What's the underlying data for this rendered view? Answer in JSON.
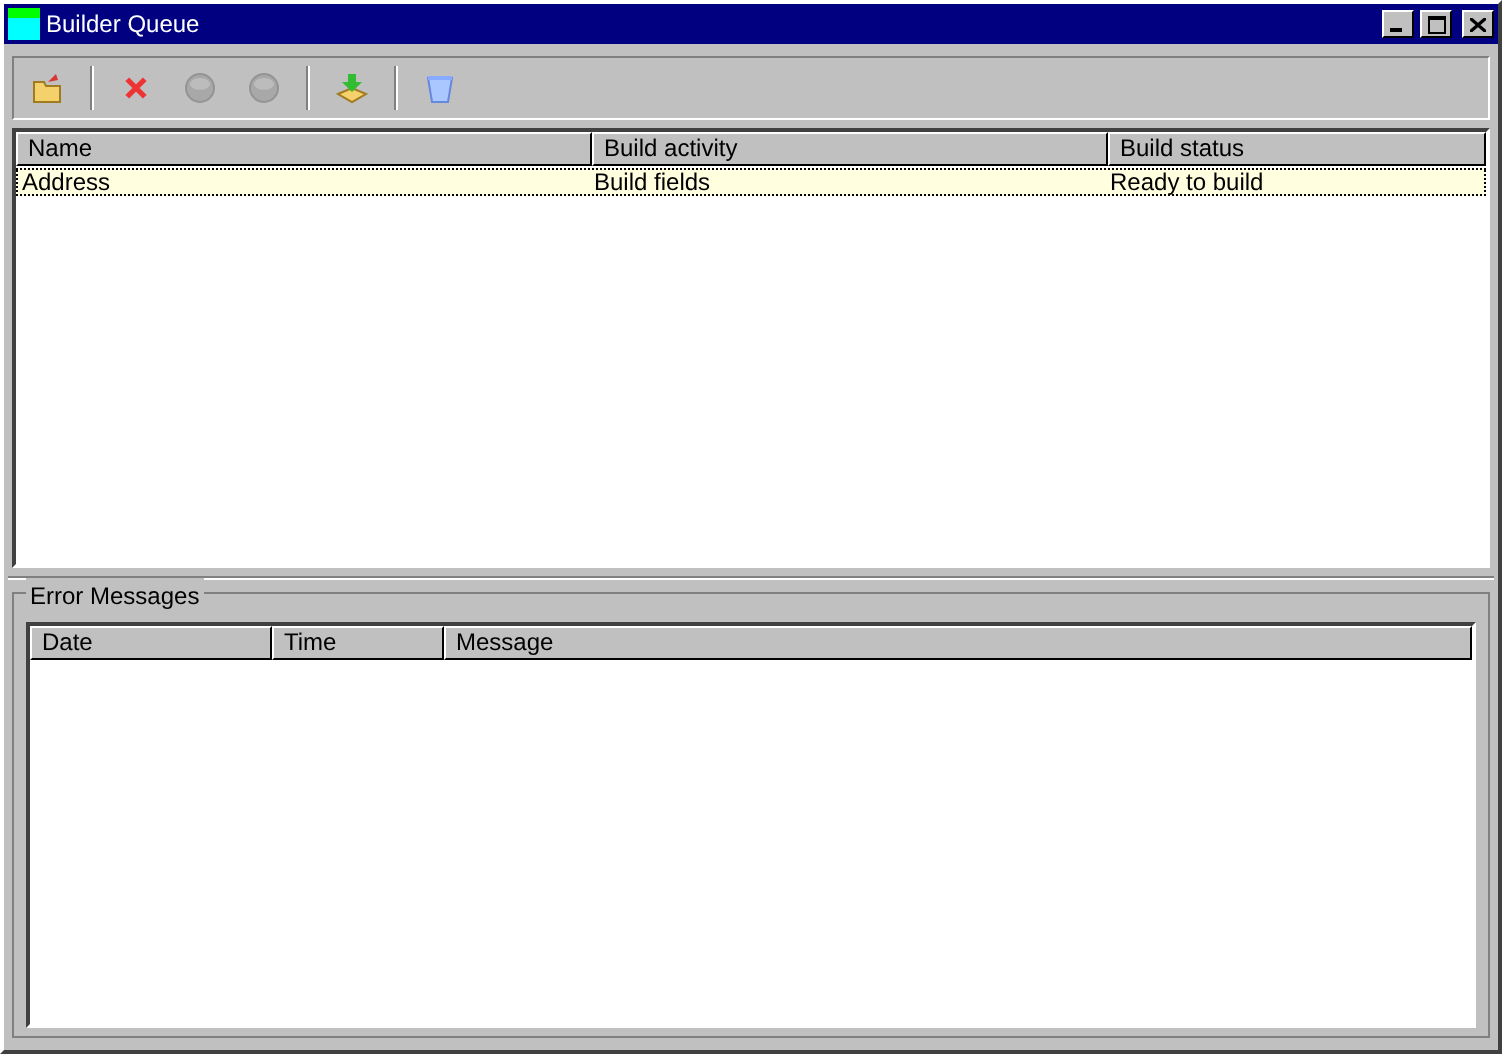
{
  "window": {
    "title": "Builder Queue"
  },
  "toolbar": [
    {
      "kind": "open",
      "disabled": false
    },
    {
      "kind": "separator"
    },
    {
      "kind": "delete",
      "disabled": false
    },
    {
      "kind": "circle",
      "disabled": true
    },
    {
      "kind": "circle",
      "disabled": true
    },
    {
      "kind": "separator"
    },
    {
      "kind": "download",
      "disabled": false
    },
    {
      "kind": "separator"
    },
    {
      "kind": "bucket",
      "disabled": false
    }
  ],
  "queue": {
    "columns": [
      "Name",
      "Build activity",
      "Build status"
    ],
    "rows": [
      {
        "cells": [
          "Address",
          "Build fields",
          "Ready to build"
        ],
        "selected": true
      }
    ]
  },
  "errors": {
    "title": "Error Messages",
    "columns": [
      "Date",
      "Time",
      "Message"
    ]
  }
}
